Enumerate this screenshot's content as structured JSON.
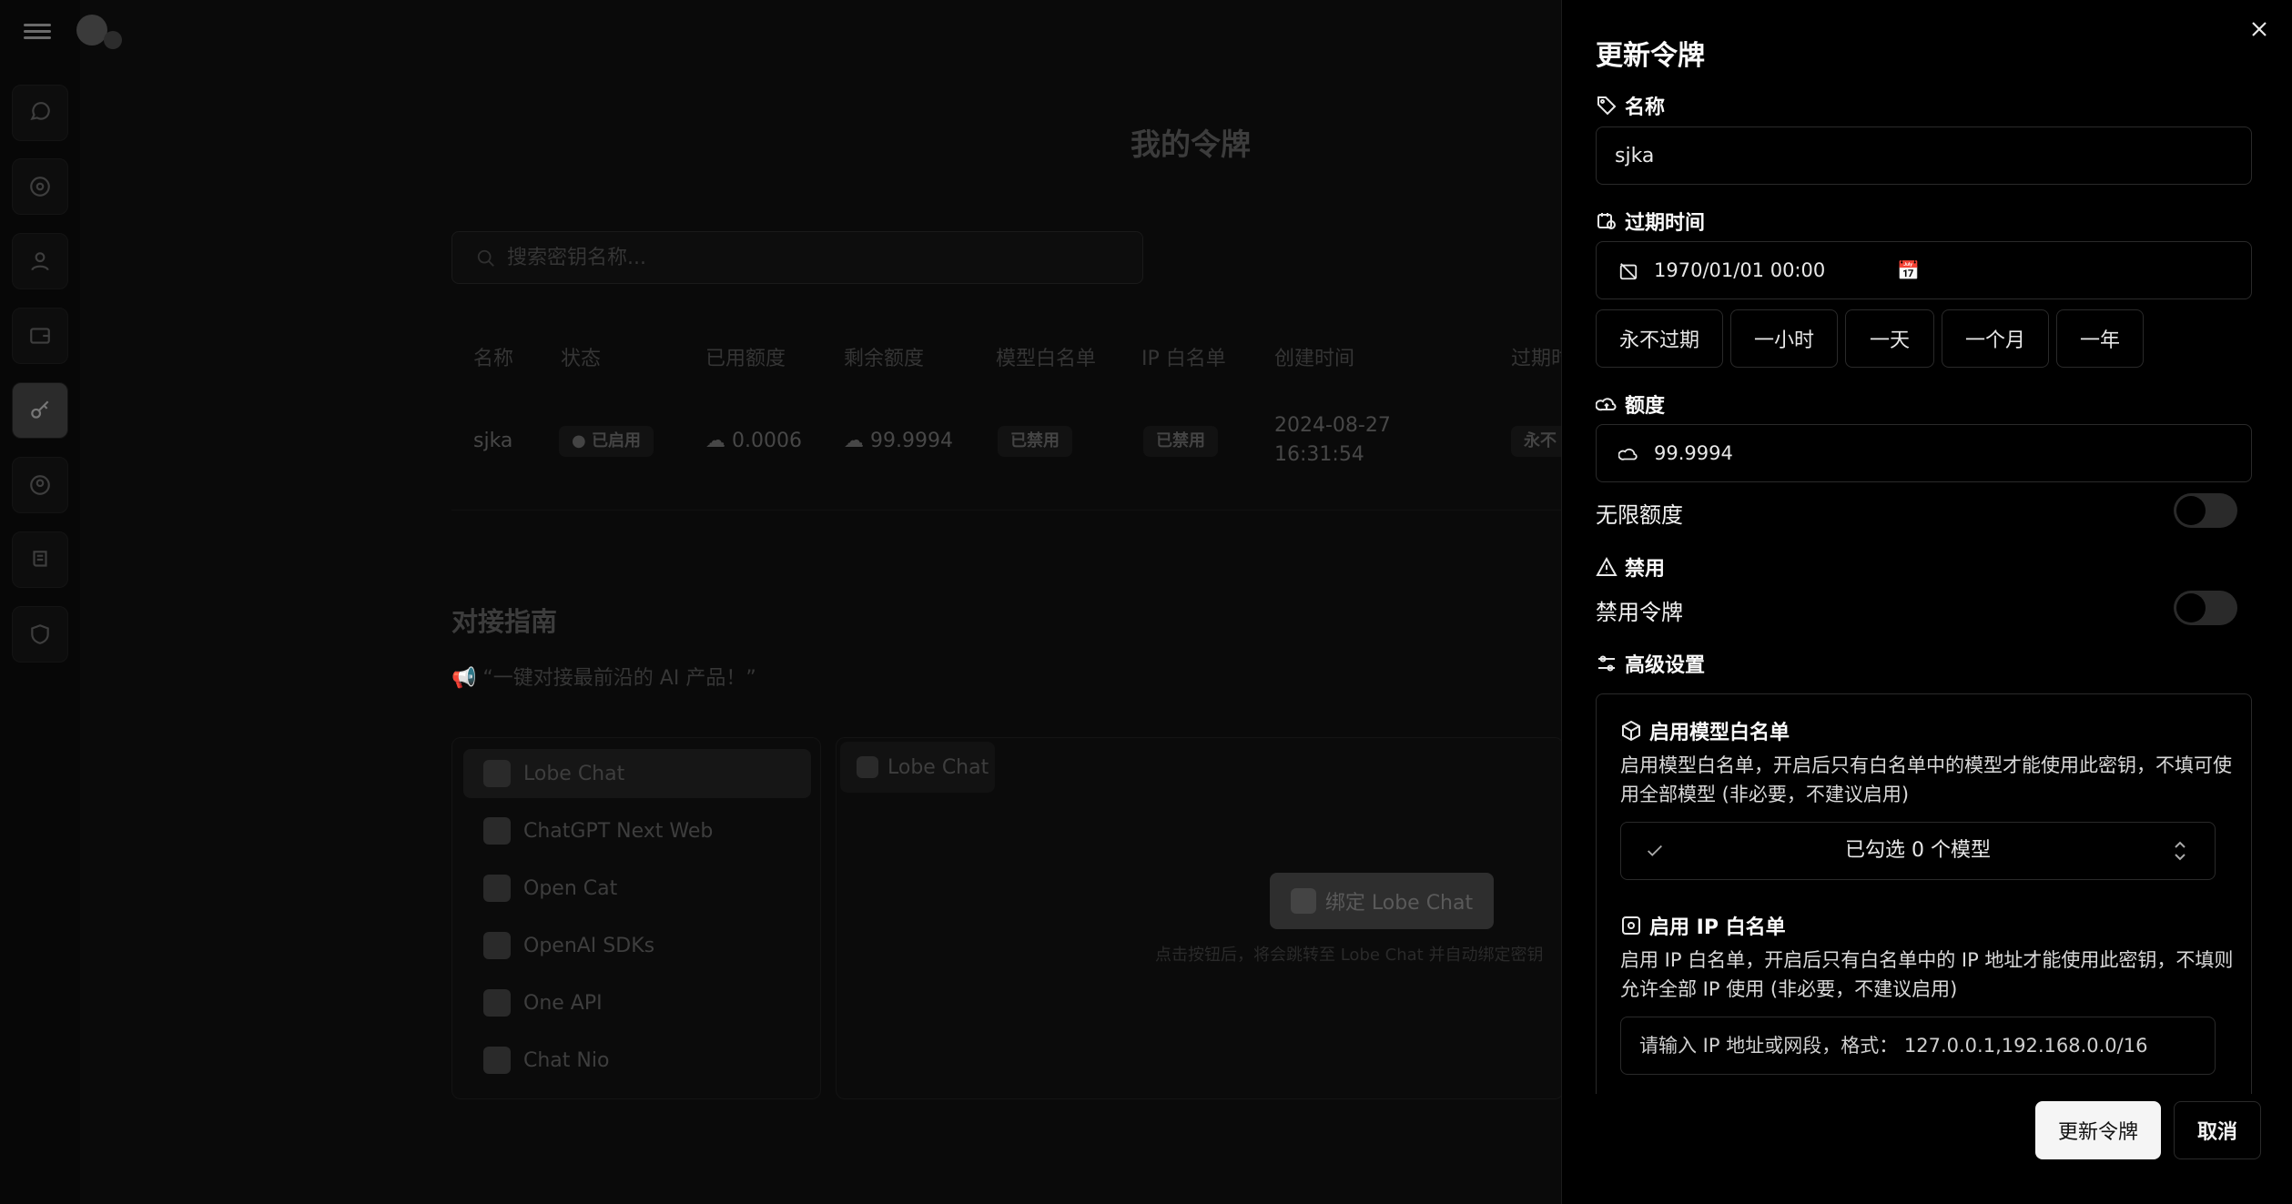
{
  "page": {
    "title": "我的令牌",
    "search_placeholder": "搜索密钥名称...",
    "table_headers": [
      "名称",
      "状态",
      "已用额度",
      "剩余额度",
      "模型白名单",
      "IP 白名单",
      "创建时间",
      "过期时"
    ],
    "row": {
      "name": "sjka",
      "status": "已启用",
      "used": "0.0006",
      "remaining": "99.9994",
      "model_whitelist": "已禁用",
      "ip_whitelist": "已禁用",
      "created_date": "2024-08-27",
      "created_time": "16:31:54",
      "expiry": "永不"
    }
  },
  "guide": {
    "title": "对接指南",
    "quote": "“一键对接最前沿的 AI 产品！”",
    "items": [
      "Lobe Chat",
      "ChatGPT Next Web",
      "Open Cat",
      "OpenAI SDKs",
      "One API",
      "Chat Nio"
    ],
    "panel_tab": "Lobe Chat",
    "bind_button": "绑定 Lobe Chat",
    "bind_hint": "点击按钮后，将会跳转至 Lobe Chat 并自动绑定密钥"
  },
  "drawer": {
    "title": "更新令牌",
    "name_label": "名称",
    "name_value": "sjka",
    "expiry_label": "过期时间",
    "expiry_value": "1970/01/01 00:00",
    "presets": [
      "永不过期",
      "一小时",
      "一天",
      "一个月",
      "一年"
    ],
    "quota_label": "额度",
    "quota_value": "99.9994",
    "unlimited_label": "无限额度",
    "unlimited_on": false,
    "disable_section": "禁用",
    "disable_label": "禁用令牌",
    "disable_on": false,
    "advanced_label": "高级设置",
    "model_wl_title": "启用模型白名单",
    "model_wl_desc": "启用模型白名单，开启后只有白名单中的模型才能使用此密钥，不填可使用全部模型 (非必要，不建议启用)",
    "model_select": "已勾选 0 个模型",
    "ip_wl_title": "启用 IP 白名单",
    "ip_wl_desc": "启用 IP 白名单，开启后只有白名单中的 IP 地址才能使用此密钥，不填则允许全部 IP 使用 (非必要，不建议启用)",
    "ip_placeholder": "请输入 IP 地址或网段，格式： 127.0.0.1,192.168.0.0/16",
    "submit": "更新令牌",
    "cancel": "取消"
  }
}
